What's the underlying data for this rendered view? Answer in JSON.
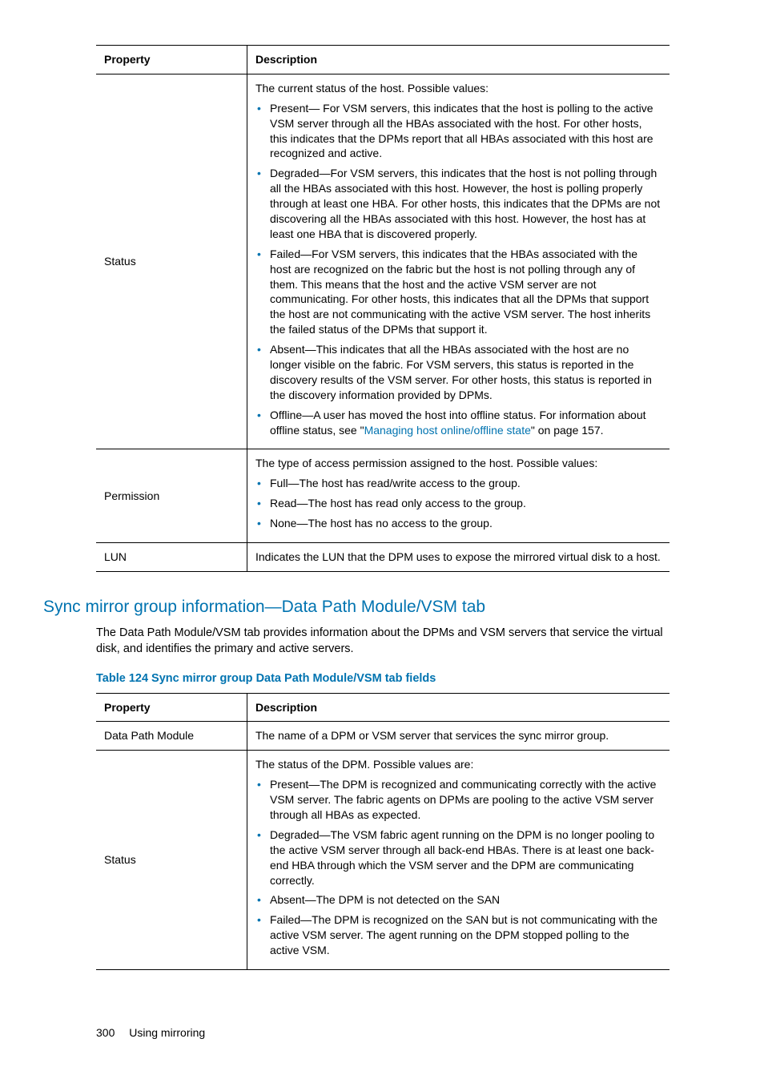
{
  "table1": {
    "head_property": "Property",
    "head_description": "Description",
    "rows": {
      "status": {
        "prop": "Status",
        "intro": "The current status of the host. Possible values:",
        "b0": "Present— For VSM servers, this indicates that the host is polling to the active VSM server through all the HBAs associated with the host. For other hosts, this indicates that the DPMs report that all HBAs associated with this host are recognized and active.",
        "b1": "Degraded—For VSM servers, this indicates that the host is not polling through all the HBAs associated with this host. However, the host is polling properly through at least one HBA. For other hosts, this indicates that the DPMs are not discovering all the HBAs associated with this host. However, the host has at least one HBA that is discovered properly.",
        "b2": "Failed—For VSM servers, this indicates that the HBAs associated with the host are recognized on the fabric but the host is not polling through any of them. This means that the host and the active VSM server are not communicating. For other hosts, this indicates that all the DPMs that support the host are not communicating with the active VSM server. The host inherits the failed status of the DPMs that support it.",
        "b3": "Absent—This indicates that all the HBAs associated with the host are no longer visible on the fabric. For VSM servers, this status is reported in the discovery results of the VSM server. For other hosts, this status is reported in the discovery information provided by DPMs.",
        "b4_pre": "Offline—A user has moved the host into offline status. For information about offline status, see \"",
        "b4_link": "Managing host online/offline state",
        "b4_post": "\" on page 157."
      },
      "permission": {
        "prop": "Permission",
        "intro": "The type of access permission assigned to the host. Possible values:",
        "b0": "Full—The host has read/write access to the group.",
        "b1": "Read—The host has read only access to the group.",
        "b2": "None—The host has no access to the group."
      },
      "lun": {
        "prop": "LUN",
        "desc": "Indicates the LUN that the DPM uses to expose the mirrored virtual disk to a host."
      }
    }
  },
  "section": {
    "heading": "Sync mirror group information—Data Path Module/VSM tab",
    "body": "The Data Path Module/VSM tab provides information about the DPMs and VSM servers that service the virtual disk, and identifies the primary and active servers.",
    "caption": "Table 124 Sync mirror group Data Path Module/VSM tab fields"
  },
  "table2": {
    "head_property": "Property",
    "head_description": "Description",
    "rows": {
      "dpm": {
        "prop": "Data Path Module",
        "desc": "The name of a DPM or VSM server that services the sync mirror group."
      },
      "status": {
        "prop": "Status",
        "intro": "The status of the DPM. Possible values are:",
        "b0": "Present—The DPM is recognized and communicating correctly with the active VSM server. The fabric agents on DPMs are pooling to the active VSM server through all HBAs as expected.",
        "b1": "Degraded—The VSM fabric agent running on the DPM is no longer pooling to the active VSM server through all back-end HBAs. There is at least one back-end HBA through which the VSM server and the DPM are communicating correctly.",
        "b2": "Absent—The DPM is not detected on the SAN",
        "b3": "Failed—The DPM is recognized on the SAN but is not communicating with the active VSM server. The agent running on the DPM stopped polling to the active VSM."
      }
    }
  },
  "footer": {
    "page_number": "300",
    "section_title": "Using mirroring"
  }
}
